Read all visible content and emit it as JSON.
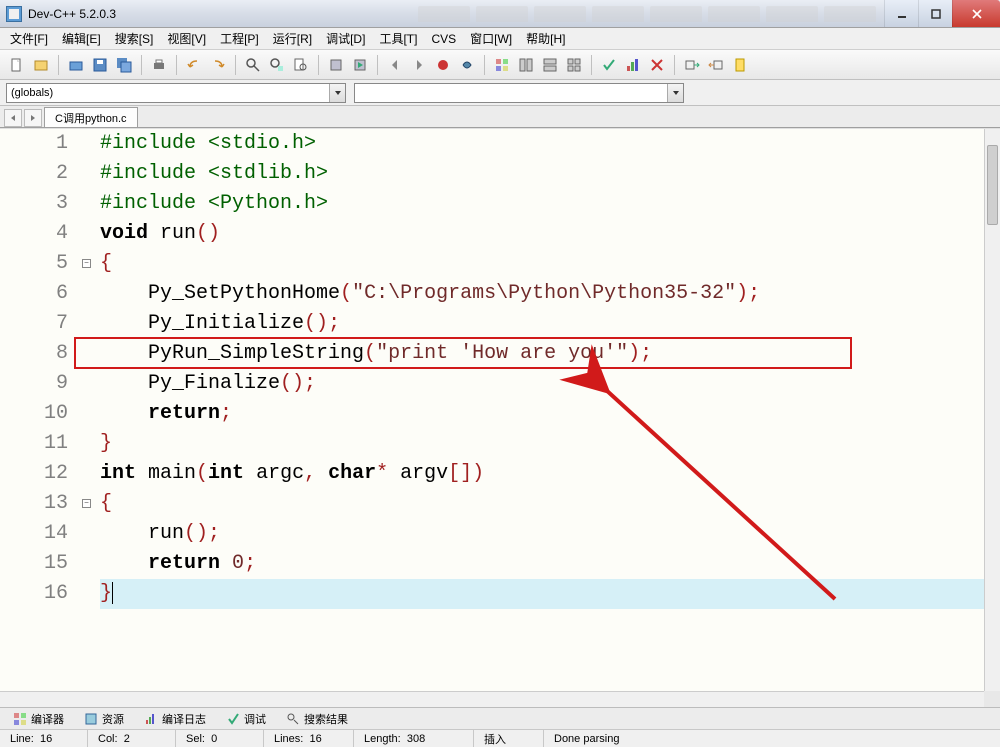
{
  "window": {
    "title": "Dev-C++ 5.2.0.3"
  },
  "menu": [
    "文件[F]",
    "编辑[E]",
    "搜索[S]",
    "视图[V]",
    "工程[P]",
    "运行[R]",
    "调试[D]",
    "工具[T]",
    "CVS",
    "窗口[W]",
    "帮助[H]"
  ],
  "combos": {
    "globals": "(globals)",
    "second": ""
  },
  "tab": {
    "filename": "C调用python.c"
  },
  "code": {
    "lines": [
      [
        {
          "t": "#include ",
          "c": "pre"
        },
        {
          "t": "<stdio.h>",
          "c": "pre"
        }
      ],
      [
        {
          "t": "#include ",
          "c": "pre"
        },
        {
          "t": "<stdlib.h>",
          "c": "pre"
        }
      ],
      [
        {
          "t": "#include ",
          "c": "pre"
        },
        {
          "t": "<Python.h>",
          "c": "pre"
        }
      ],
      [
        {
          "t": "void",
          "c": "kw"
        },
        {
          "t": " run",
          "c": "fn"
        },
        {
          "t": "()",
          "c": "sym"
        }
      ],
      [
        {
          "t": "{",
          "c": "sym"
        }
      ],
      [
        {
          "t": "    Py_SetPythonHome",
          "c": "fn"
        },
        {
          "t": "(",
          "c": "sym"
        },
        {
          "t": "\"C:\\Programs\\Python\\Python35-32\"",
          "c": "str"
        },
        {
          "t": ")",
          "c": "sym"
        },
        {
          "t": ";",
          "c": "sym"
        }
      ],
      [
        {
          "t": "    Py_Initialize",
          "c": "fn"
        },
        {
          "t": "()",
          "c": "sym"
        },
        {
          "t": ";",
          "c": "sym"
        }
      ],
      [
        {
          "t": "    PyRun_SimpleString",
          "c": "fn"
        },
        {
          "t": "(",
          "c": "sym"
        },
        {
          "t": "\"print 'How are you'\"",
          "c": "str"
        },
        {
          "t": ")",
          "c": "sym"
        },
        {
          "t": ";",
          "c": "sym"
        }
      ],
      [
        {
          "t": "    Py_Finalize",
          "c": "fn"
        },
        {
          "t": "()",
          "c": "sym"
        },
        {
          "t": ";",
          "c": "sym"
        }
      ],
      [
        {
          "t": "    ",
          "c": "fn"
        },
        {
          "t": "return",
          "c": "kw"
        },
        {
          "t": ";",
          "c": "sym"
        }
      ],
      [
        {
          "t": "}",
          "c": "sym"
        }
      ],
      [
        {
          "t": "int",
          "c": "kw"
        },
        {
          "t": " main",
          "c": "fn"
        },
        {
          "t": "(",
          "c": "sym"
        },
        {
          "t": "int",
          "c": "kw"
        },
        {
          "t": " argc",
          "c": "fn"
        },
        {
          "t": ",",
          "c": "sym"
        },
        {
          "t": " ",
          "c": "fn"
        },
        {
          "t": "char",
          "c": "kw"
        },
        {
          "t": "*",
          "c": "sym"
        },
        {
          "t": " argv",
          "c": "fn"
        },
        {
          "t": "[]",
          "c": "sym"
        },
        {
          "t": ")",
          "c": "sym"
        }
      ],
      [
        {
          "t": "{",
          "c": "sym"
        }
      ],
      [
        {
          "t": "    run",
          "c": "fn"
        },
        {
          "t": "()",
          "c": "sym"
        },
        {
          "t": ";",
          "c": "sym"
        }
      ],
      [
        {
          "t": "    ",
          "c": "fn"
        },
        {
          "t": "return",
          "c": "kw"
        },
        {
          "t": " ",
          "c": "fn"
        },
        {
          "t": "0",
          "c": "num"
        },
        {
          "t": ";",
          "c": "sym"
        }
      ],
      [
        {
          "t": "}",
          "c": "sym"
        }
      ]
    ],
    "fold_markers": [
      5,
      13
    ],
    "highlight_line": 16,
    "red_box_line": 8
  },
  "bottom_tabs": [
    "编译器",
    "资源",
    "编译日志",
    "调试",
    "搜索结果"
  ],
  "status": {
    "line_lbl": "Line:",
    "line": "16",
    "col_lbl": "Col:",
    "col": "2",
    "sel_lbl": "Sel:",
    "sel": "0",
    "lines_lbl": "Lines:",
    "lines": "16",
    "len_lbl": "Length:",
    "len": "308",
    "mode": "插入",
    "parse": "Done parsing"
  }
}
